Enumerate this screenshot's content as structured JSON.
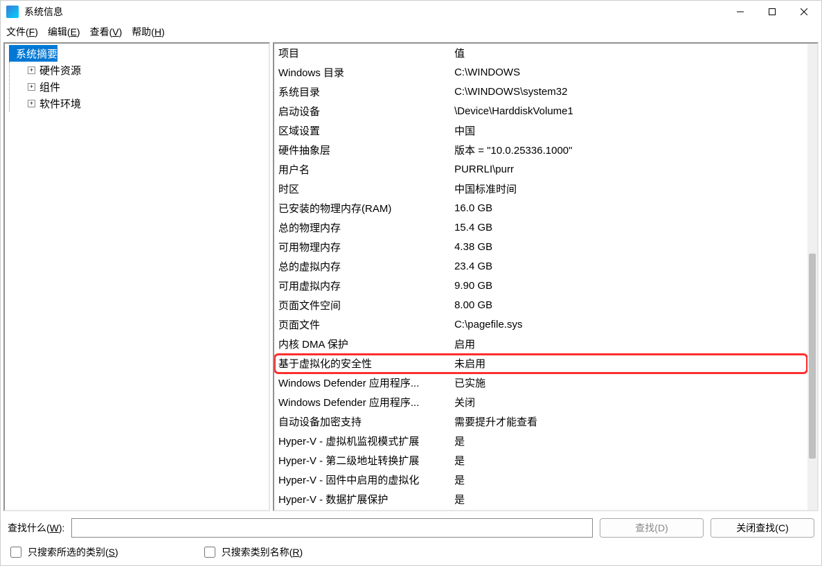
{
  "window": {
    "title": "系统信息"
  },
  "menu": {
    "file": "文件",
    "file_key": "F",
    "edit": "编辑",
    "edit_key": "E",
    "view": "查看",
    "view_key": "V",
    "help": "帮助",
    "help_key": "H"
  },
  "tree": {
    "root": "系统摘要",
    "items": [
      {
        "label": "硬件资源",
        "expandable": true
      },
      {
        "label": "组件",
        "expandable": true
      },
      {
        "label": "软件环境",
        "expandable": true
      }
    ]
  },
  "detail": {
    "header_item": "项目",
    "header_value": "值",
    "rows": [
      {
        "item": "Windows 目录",
        "value": "C:\\WINDOWS",
        "hl": false
      },
      {
        "item": "系统目录",
        "value": "C:\\WINDOWS\\system32",
        "hl": false
      },
      {
        "item": "启动设备",
        "value": "\\Device\\HarddiskVolume1",
        "hl": false
      },
      {
        "item": "区域设置",
        "value": "中国",
        "hl": false
      },
      {
        "item": "硬件抽象层",
        "value": "版本 = \"10.0.25336.1000\"",
        "hl": false
      },
      {
        "item": "用户名",
        "value": "PURRLI\\purr",
        "hl": false
      },
      {
        "item": "时区",
        "value": "中国标准时间",
        "hl": false
      },
      {
        "item": "已安装的物理内存(RAM)",
        "value": "16.0 GB",
        "hl": false
      },
      {
        "item": "总的物理内存",
        "value": "15.4 GB",
        "hl": false
      },
      {
        "item": "可用物理内存",
        "value": "4.38 GB",
        "hl": false
      },
      {
        "item": "总的虚拟内存",
        "value": "23.4 GB",
        "hl": false
      },
      {
        "item": "可用虚拟内存",
        "value": "9.90 GB",
        "hl": false
      },
      {
        "item": "页面文件空间",
        "value": "8.00 GB",
        "hl": false
      },
      {
        "item": "页面文件",
        "value": "C:\\pagefile.sys",
        "hl": false
      },
      {
        "item": "内核 DMA 保护",
        "value": "启用",
        "hl": false
      },
      {
        "item": "基于虚拟化的安全性",
        "value": "未启用",
        "hl": true
      },
      {
        "item": "Windows Defender 应用程序...",
        "value": "已实施",
        "hl": false
      },
      {
        "item": "Windows Defender 应用程序...",
        "value": "关闭",
        "hl": false
      },
      {
        "item": "自动设备加密支持",
        "value": "需要提升才能查看",
        "hl": false
      },
      {
        "item": "Hyper-V - 虚拟机监视模式扩展",
        "value": "是",
        "hl": false
      },
      {
        "item": "Hyper-V - 第二级地址转换扩展",
        "value": "是",
        "hl": false
      },
      {
        "item": "Hyper-V - 固件中启用的虚拟化",
        "value": "是",
        "hl": false
      },
      {
        "item": "Hyper-V - 数据扩展保护",
        "value": "是",
        "hl": false
      }
    ]
  },
  "search": {
    "label": "查找什么",
    "label_key": "W",
    "find_btn": "查找",
    "find_key": "D",
    "close_find_btn": "关闭查找",
    "close_find_key": "C",
    "chk_category": "只搜索所选的类别",
    "chk_category_key": "S",
    "chk_name_only": "只搜索类别名称",
    "chk_name_only_key": "R"
  }
}
